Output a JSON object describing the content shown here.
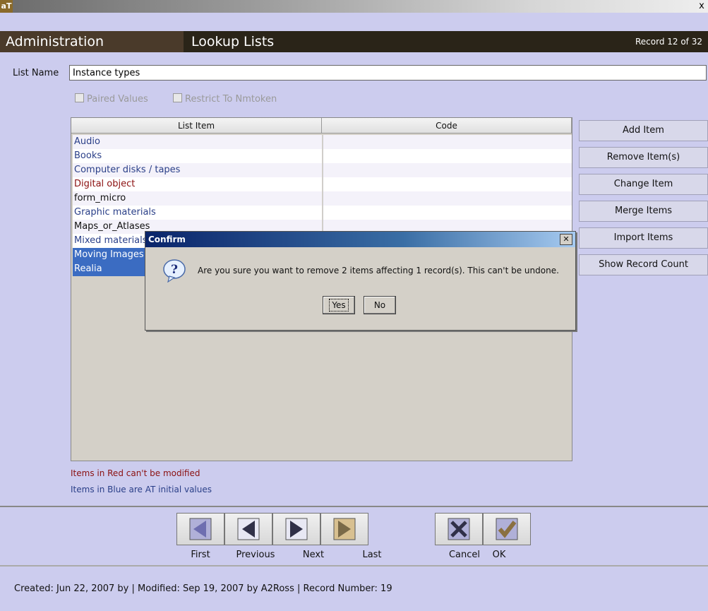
{
  "window": {
    "logo": "aT",
    "close_glyph": "x"
  },
  "header": {
    "section": "Administration",
    "title": "Lookup Lists",
    "record_indicator": "Record 12 of 32"
  },
  "form": {
    "list_name_label": "List Name",
    "list_name_value": "Instance types",
    "paired_values_label": "Paired Values",
    "restrict_label": "Restrict To Nmtoken"
  },
  "table": {
    "columns": [
      "List Item",
      "Code"
    ],
    "rows": [
      {
        "item": "Audio",
        "code": "",
        "color": "#2a3f88"
      },
      {
        "item": "Books",
        "code": "",
        "color": "#2a3f88"
      },
      {
        "item": "Computer disks / tapes",
        "code": "",
        "color": "#2a3f88"
      },
      {
        "item": "Digital object",
        "code": "",
        "color": "#8b1010"
      },
      {
        "item": "form_micro",
        "code": "",
        "color": "#111111"
      },
      {
        "item": "Graphic materials",
        "code": "",
        "color": "#2a3f88"
      },
      {
        "item": "Maps_or_Atlases",
        "code": "",
        "color": "#111111"
      },
      {
        "item": "Mixed materials",
        "code": "",
        "color": "#2a3f88"
      },
      {
        "item": "Moving Images",
        "code": "",
        "color": "#ffffff"
      },
      {
        "item": "Realia",
        "code": "",
        "color": "#ffffff"
      }
    ],
    "selected_bg": "#3b6cc2"
  },
  "side_buttons": [
    "Add Item",
    "Remove Item(s)",
    "Change Item",
    "Merge Items",
    "Import Items",
    "Show Record Count"
  ],
  "legend": {
    "red": "Items in Red can't be modified",
    "blue": "Items in Blue are AT initial values"
  },
  "nav": {
    "first": "First",
    "previous": "Previous",
    "next": "Next",
    "last": "Last",
    "cancel": "Cancel",
    "ok": "OK"
  },
  "status": "Created: Jun 22, 2007 by  | Modified: Sep 19, 2007 by A2Ross | Record Number: 19",
  "dialog": {
    "title": "Confirm",
    "message": "Are you sure you want to remove 2 items affecting 1 record(s). This can't be undone.",
    "yes": "Yes",
    "no": "No",
    "icon": "question-icon"
  },
  "colors": {
    "red_item": "#8b1010",
    "blue_item": "#2a3f88",
    "header_dark": "#2a2418"
  }
}
